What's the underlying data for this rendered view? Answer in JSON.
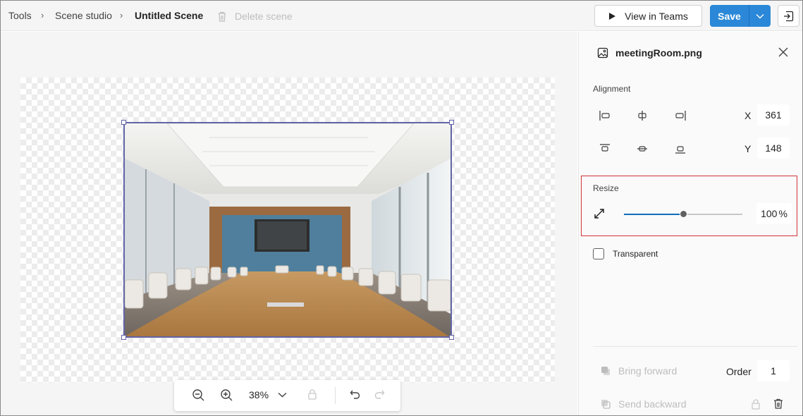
{
  "breadcrumb": {
    "items": [
      "Tools",
      "Scene studio",
      "Untitled Scene"
    ]
  },
  "toolbar": {
    "delete_label": "Delete scene",
    "view_label": "View in Teams",
    "save_label": "Save"
  },
  "zoom": {
    "value": "38%"
  },
  "panel": {
    "file_name": "meetingRoom.png",
    "alignment_label": "Alignment",
    "x_label": "X",
    "x_value": "361",
    "y_label": "Y",
    "y_value": "148",
    "resize_label": "Resize",
    "resize_value": "100",
    "resize_unit": "%",
    "resize_fraction": 0.5,
    "transparent_label": "Transparent",
    "bring_forward_label": "Bring forward",
    "send_backward_label": "Send backward",
    "order_label": "Order",
    "order_value": "1"
  },
  "colors": {
    "accent": "#2b88d8",
    "selection": "#6264a7",
    "highlight": "#d13438"
  }
}
